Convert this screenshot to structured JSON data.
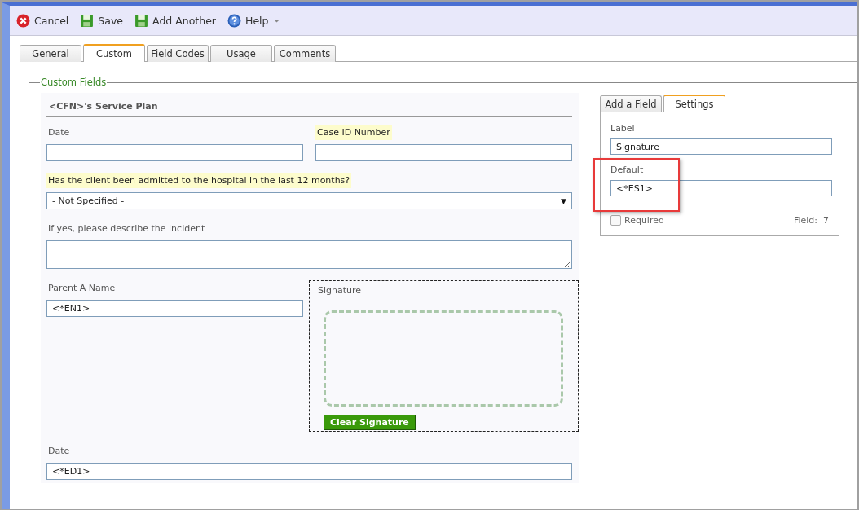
{
  "toolbar": [
    {
      "kind": "cancel",
      "label": "Cancel"
    },
    {
      "kind": "save",
      "label": "Save"
    },
    {
      "kind": "save",
      "label": "Add Another"
    },
    {
      "kind": "help",
      "label": "Help",
      "dropdown": true
    }
  ],
  "tabs": [
    {
      "label": "General",
      "selected": false
    },
    {
      "label": "Custom",
      "selected": true
    },
    {
      "label": "Field Codes",
      "selected": false
    },
    {
      "label": "Usage",
      "selected": false
    },
    {
      "label": "Comments",
      "selected": false
    }
  ],
  "fieldset": {
    "legend": "Custom Fields",
    "form": {
      "title": "<CFN>'s Service Plan",
      "rows": [
        [
          {
            "kind": "text",
            "label": "Date",
            "highlighted": false
          },
          {
            "kind": "text",
            "label": "Case ID Number",
            "highlighted": true
          }
        ],
        [
          {
            "kind": "select",
            "label": "Has the client been admitted to the hospital in the last 12 months?",
            "highlighted": true,
            "value": "- Not Specified -",
            "arrow": "▼"
          }
        ],
        [
          {
            "kind": "textarea",
            "label": "If yes, please describe the incident",
            "highlighted": false
          }
        ],
        [
          {
            "kind": "text",
            "label": "Parent A Name",
            "highlighted": false,
            "value": "<*EN1>"
          },
          {
            "kind": "signature",
            "label": "Signature",
            "button": "Clear Signature"
          }
        ],
        [
          {
            "kind": "text",
            "label": "Date",
            "highlighted": false,
            "value": "<*ED1>"
          }
        ]
      ]
    },
    "settings": {
      "tabs": [
        {
          "label": "Add a Field",
          "selected": false
        },
        {
          "label": "Settings",
          "selected": true
        }
      ],
      "label_field": {
        "label": "Label",
        "value": "Signature"
      },
      "default_field": {
        "label": "Default",
        "value": "<*ES1>"
      },
      "required": {
        "label": "Required",
        "checked": false
      },
      "field_number": {
        "label": "Field:",
        "value": "7"
      }
    }
  }
}
